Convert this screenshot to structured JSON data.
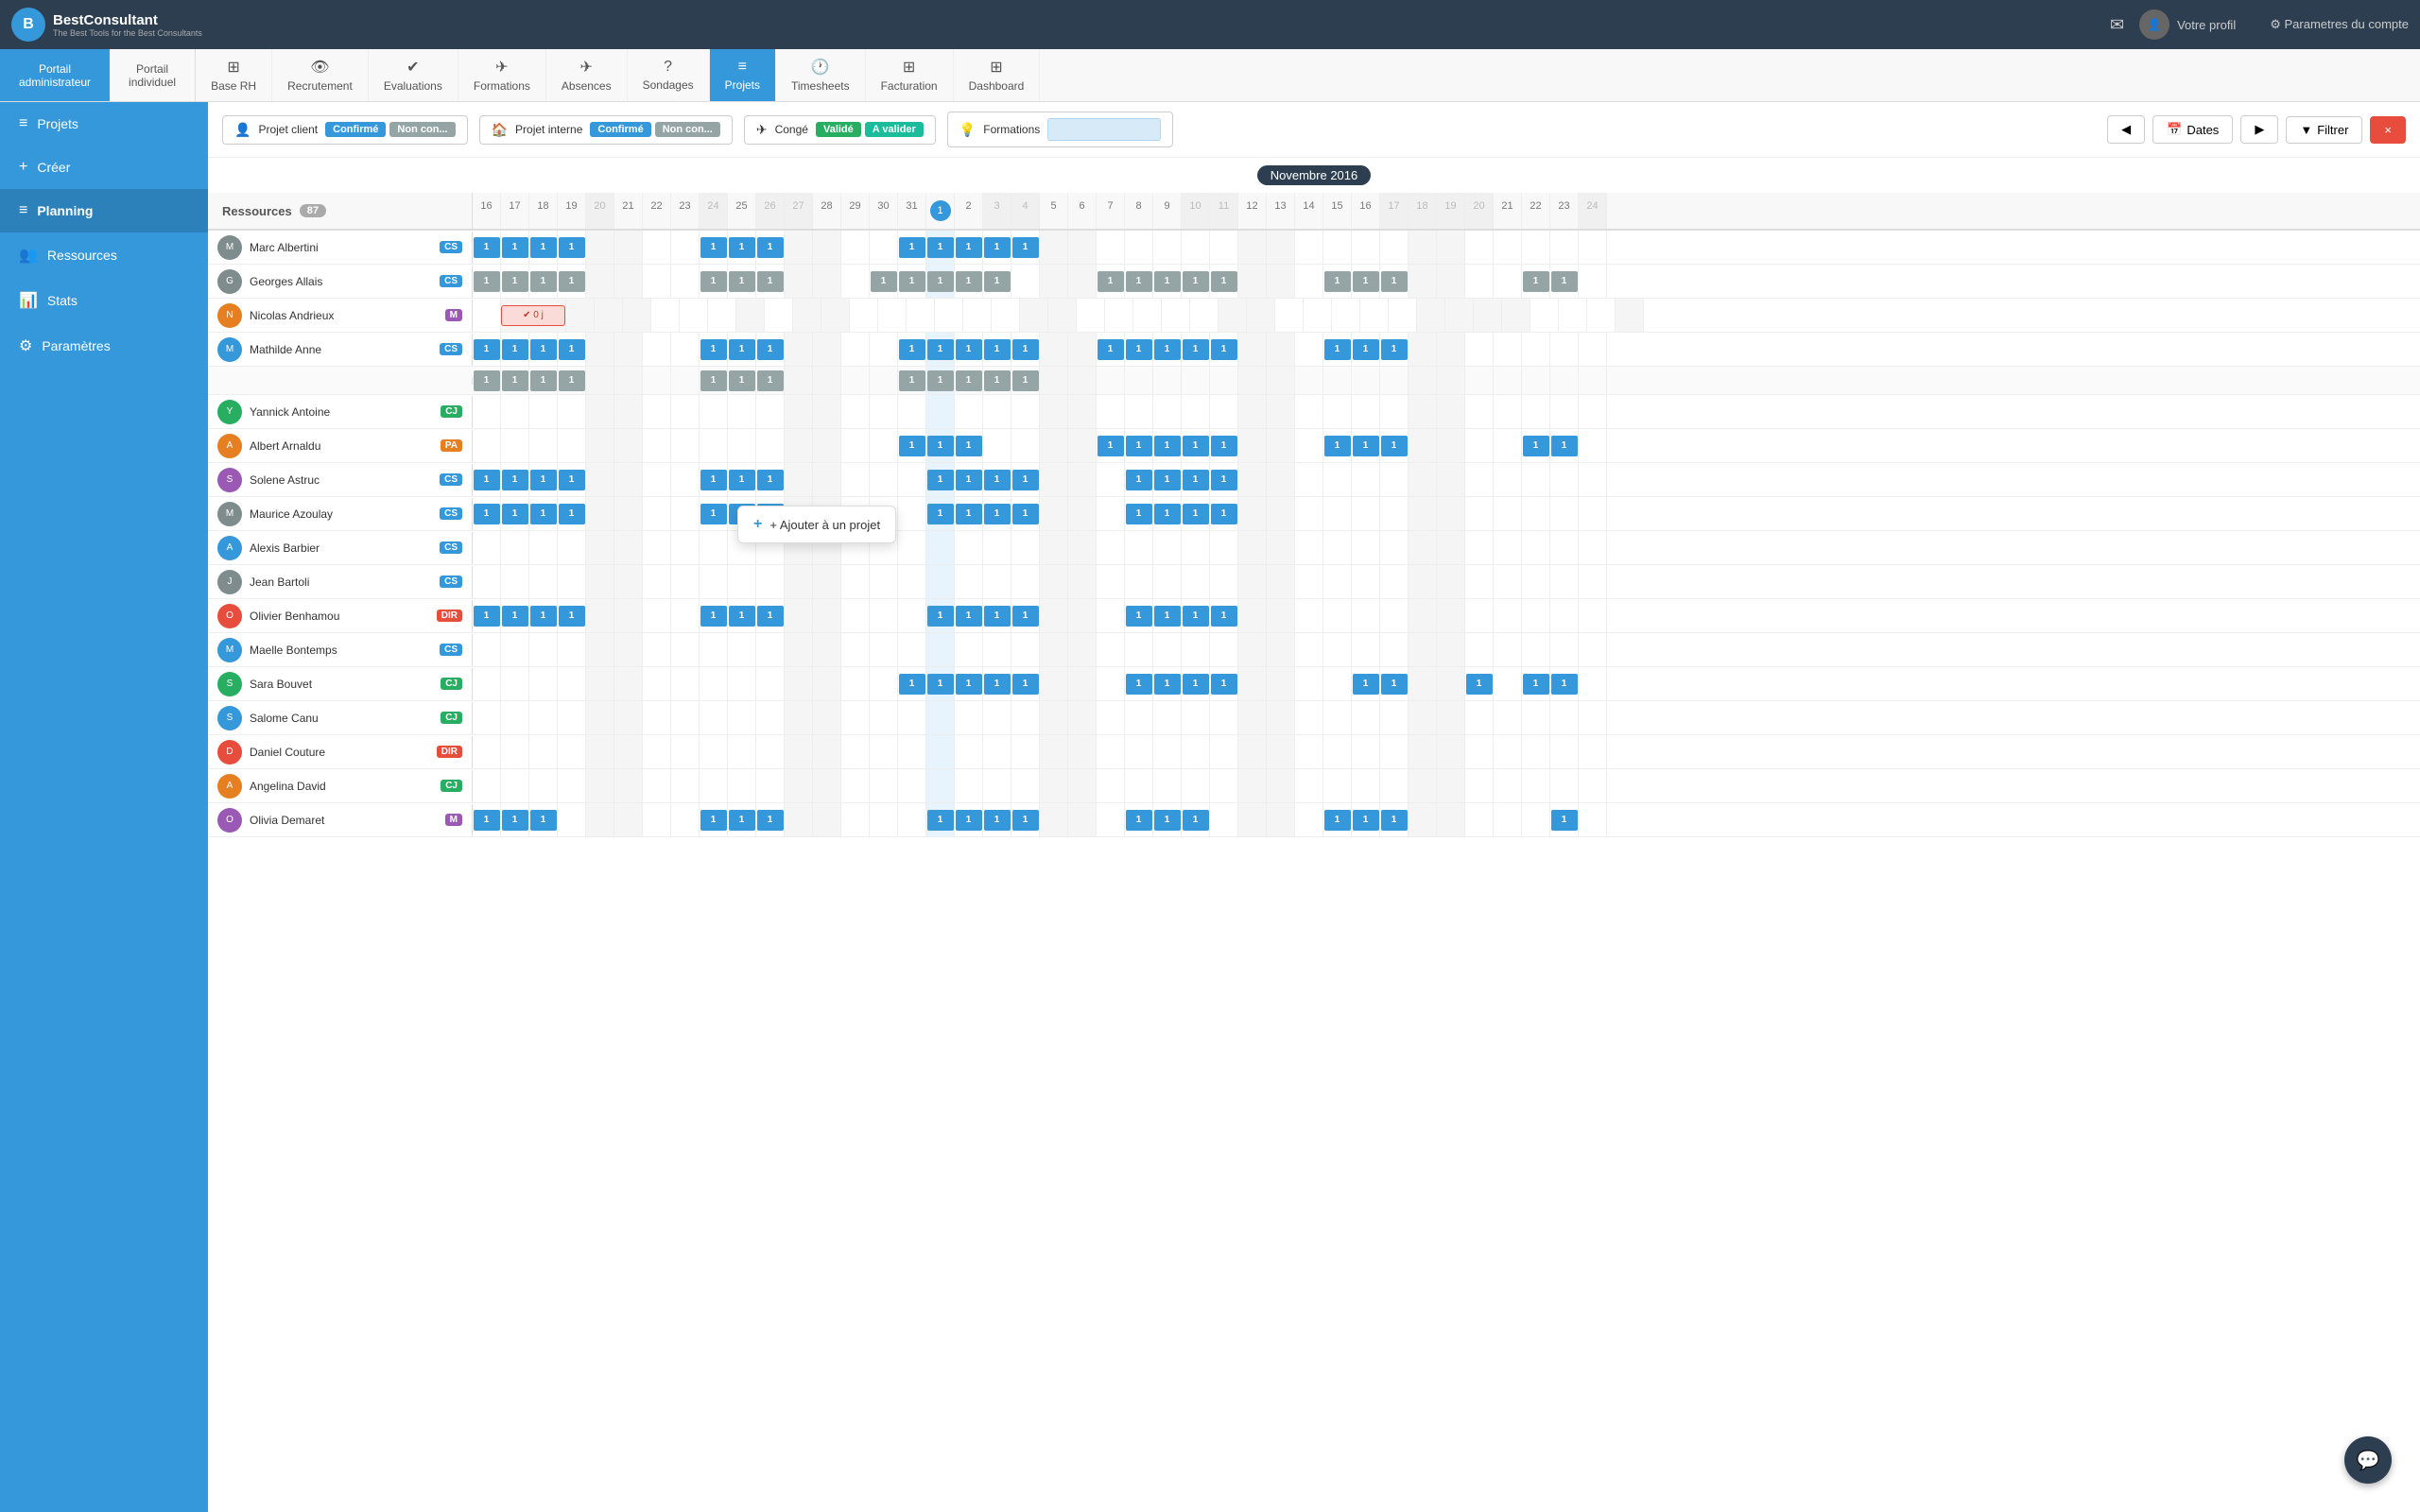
{
  "app": {
    "logo_letter": "B",
    "logo_title": "BestConsultant",
    "logo_sub": "The Best Tools for the Best Consultants"
  },
  "top_nav": {
    "mail_icon": "✉",
    "profile_label": "Votre profil",
    "settings_label": "⚙ Parametres du compte"
  },
  "portal": {
    "admin_label": "Portail",
    "admin_sub": "administrateur",
    "indiv_label": "Portail",
    "indiv_sub": "individuel"
  },
  "nav_tabs": [
    {
      "id": "base-rh",
      "icon": "⊞",
      "label": "Base RH"
    },
    {
      "id": "recrutement",
      "icon": "👁",
      "label": "Recrutement"
    },
    {
      "id": "evaluations",
      "icon": "✔",
      "label": "Evaluations"
    },
    {
      "id": "formations",
      "icon": "✈",
      "label": "Formations"
    },
    {
      "id": "absences",
      "icon": "✈",
      "label": "Absences"
    },
    {
      "id": "sondages",
      "icon": "?",
      "label": "Sondages"
    },
    {
      "id": "projets",
      "icon": "≡",
      "label": "Projets",
      "active": true
    },
    {
      "id": "timesheets",
      "icon": "🕐",
      "label": "Timesheets"
    },
    {
      "id": "facturation",
      "icon": "⊞",
      "label": "Facturation"
    },
    {
      "id": "dashboard",
      "icon": "⊞",
      "label": "Dashboard"
    }
  ],
  "sidebar": {
    "items": [
      {
        "id": "projets",
        "icon": "≡",
        "label": "Projets"
      },
      {
        "id": "creer",
        "icon": "+",
        "label": "Créer"
      },
      {
        "id": "planning",
        "icon": "≡",
        "label": "Planning",
        "active": true
      },
      {
        "id": "ressources",
        "icon": "👥",
        "label": "Ressources"
      },
      {
        "id": "stats",
        "icon": "📊",
        "label": "Stats"
      },
      {
        "id": "parametres",
        "icon": "⚙",
        "label": "Paramètres"
      }
    ]
  },
  "legend": {
    "items": [
      {
        "id": "projet-client",
        "icon": "👤",
        "label": "Projet client",
        "badges": [
          "Confirmé",
          "Non con..."
        ]
      },
      {
        "id": "projet-interne",
        "icon": "🏠",
        "label": "Projet interne",
        "badges": [
          "Confirmé",
          "Non con..."
        ]
      },
      {
        "id": "conge",
        "icon": "✈",
        "label": "Congé",
        "badges": [
          "Validé",
          "A valider"
        ]
      },
      {
        "id": "formations",
        "icon": "💡",
        "label": "Formations"
      }
    ],
    "toolbar": {
      "prev_label": "◀",
      "dates_label": "Dates",
      "next_label": "▶",
      "filter_label": "▼ Filtrer",
      "close_label": "×"
    }
  },
  "planning": {
    "month": "Novembre 2016",
    "resources_label": "Ressources",
    "resources_count": "87",
    "today_day": "1",
    "days": [
      16,
      17,
      18,
      19,
      20,
      21,
      22,
      23,
      24,
      25,
      26,
      27,
      28,
      29,
      30,
      31,
      1,
      2,
      3,
      4,
      5,
      6,
      7,
      8,
      9,
      10,
      11,
      12,
      13,
      14,
      15,
      16,
      17,
      18,
      19,
      20,
      21,
      22,
      23,
      24
    ],
    "weekend_days": [
      19,
      20,
      26,
      27,
      3,
      4,
      10,
      11,
      17,
      18,
      24
    ],
    "tooltip": "+ Ajouter à un projet"
  },
  "resources": [
    {
      "id": "marc-albertini",
      "name": "Marc Albertini",
      "badge": "CS",
      "badge_class": "rb-cs",
      "color": "#3498db",
      "avatar_color": "#7f8c8d"
    },
    {
      "id": "georges-allais",
      "name": "Georges Allais",
      "badge": "CS",
      "badge_class": "rb-cs",
      "color": "#95a5a6",
      "avatar_color": "#7f8c8d"
    },
    {
      "id": "nicolas-andrieux",
      "name": "Nicolas Andrieux",
      "badge": "M",
      "badge_class": "rb-m",
      "avatar_color": "#e67e22"
    },
    {
      "id": "mathilde-anne",
      "name": "Mathilde Anne",
      "badge": "CS",
      "badge_class": "rb-cs",
      "avatar_color": "#3498db"
    },
    {
      "id": "mathilde-anne-sub",
      "name": "",
      "badge": "",
      "badge_class": "",
      "is_sub": true
    },
    {
      "id": "yannick-antoine",
      "name": "Yannick Antoine",
      "badge": "CJ",
      "badge_class": "rb-cj",
      "avatar_color": "#27ae60"
    },
    {
      "id": "albert-arnaldu",
      "name": "Albert Arnaldu",
      "badge": "PA",
      "badge_class": "rb-pa",
      "avatar_color": "#e67e22"
    },
    {
      "id": "solene-astruc",
      "name": "Solene Astruc",
      "badge": "CS",
      "badge_class": "rb-cs",
      "avatar_color": "#9b59b6"
    },
    {
      "id": "maurice-azoulay",
      "name": "Maurice Azoulay",
      "badge": "CS",
      "badge_class": "rb-cs",
      "avatar_color": "#7f8c8d"
    },
    {
      "id": "alexis-barbier",
      "name": "Alexis Barbier",
      "badge": "CS",
      "badge_class": "rb-cs",
      "avatar_color": "#3498db"
    },
    {
      "id": "jean-bartoli",
      "name": "Jean Bartoli",
      "badge": "CS",
      "badge_class": "rb-cs",
      "avatar_color": "#7f8c8d"
    },
    {
      "id": "olivier-benhamou",
      "name": "Olivier Benhamou",
      "badge": "DIR",
      "badge_class": "rb-dir",
      "avatar_color": "#e74c3c"
    },
    {
      "id": "maelle-bontemps",
      "name": "Maelle Bontemps",
      "badge": "CS",
      "badge_class": "rb-cs",
      "avatar_color": "#3498db"
    },
    {
      "id": "sara-bouvet",
      "name": "Sara Bouvet",
      "badge": "CJ",
      "badge_class": "rb-cj",
      "avatar_color": "#27ae60"
    },
    {
      "id": "salome-canu",
      "name": "Salome Canu",
      "badge": "CJ",
      "badge_class": "rb-cj",
      "avatar_color": "#3498db"
    },
    {
      "id": "daniel-couture",
      "name": "Daniel Couture",
      "badge": "DIR",
      "badge_class": "rb-dir",
      "avatar_color": "#e74c3c"
    },
    {
      "id": "angelina-david",
      "name": "Angelina David",
      "badge": "CJ",
      "badge_class": "rb-cj",
      "avatar_color": "#e67e22"
    },
    {
      "id": "olivia-demaret",
      "name": "Olivia Demaret",
      "badge": "M",
      "badge_class": "rb-m",
      "avatar_color": "#9b59b6"
    }
  ],
  "chat_icon": "💬"
}
